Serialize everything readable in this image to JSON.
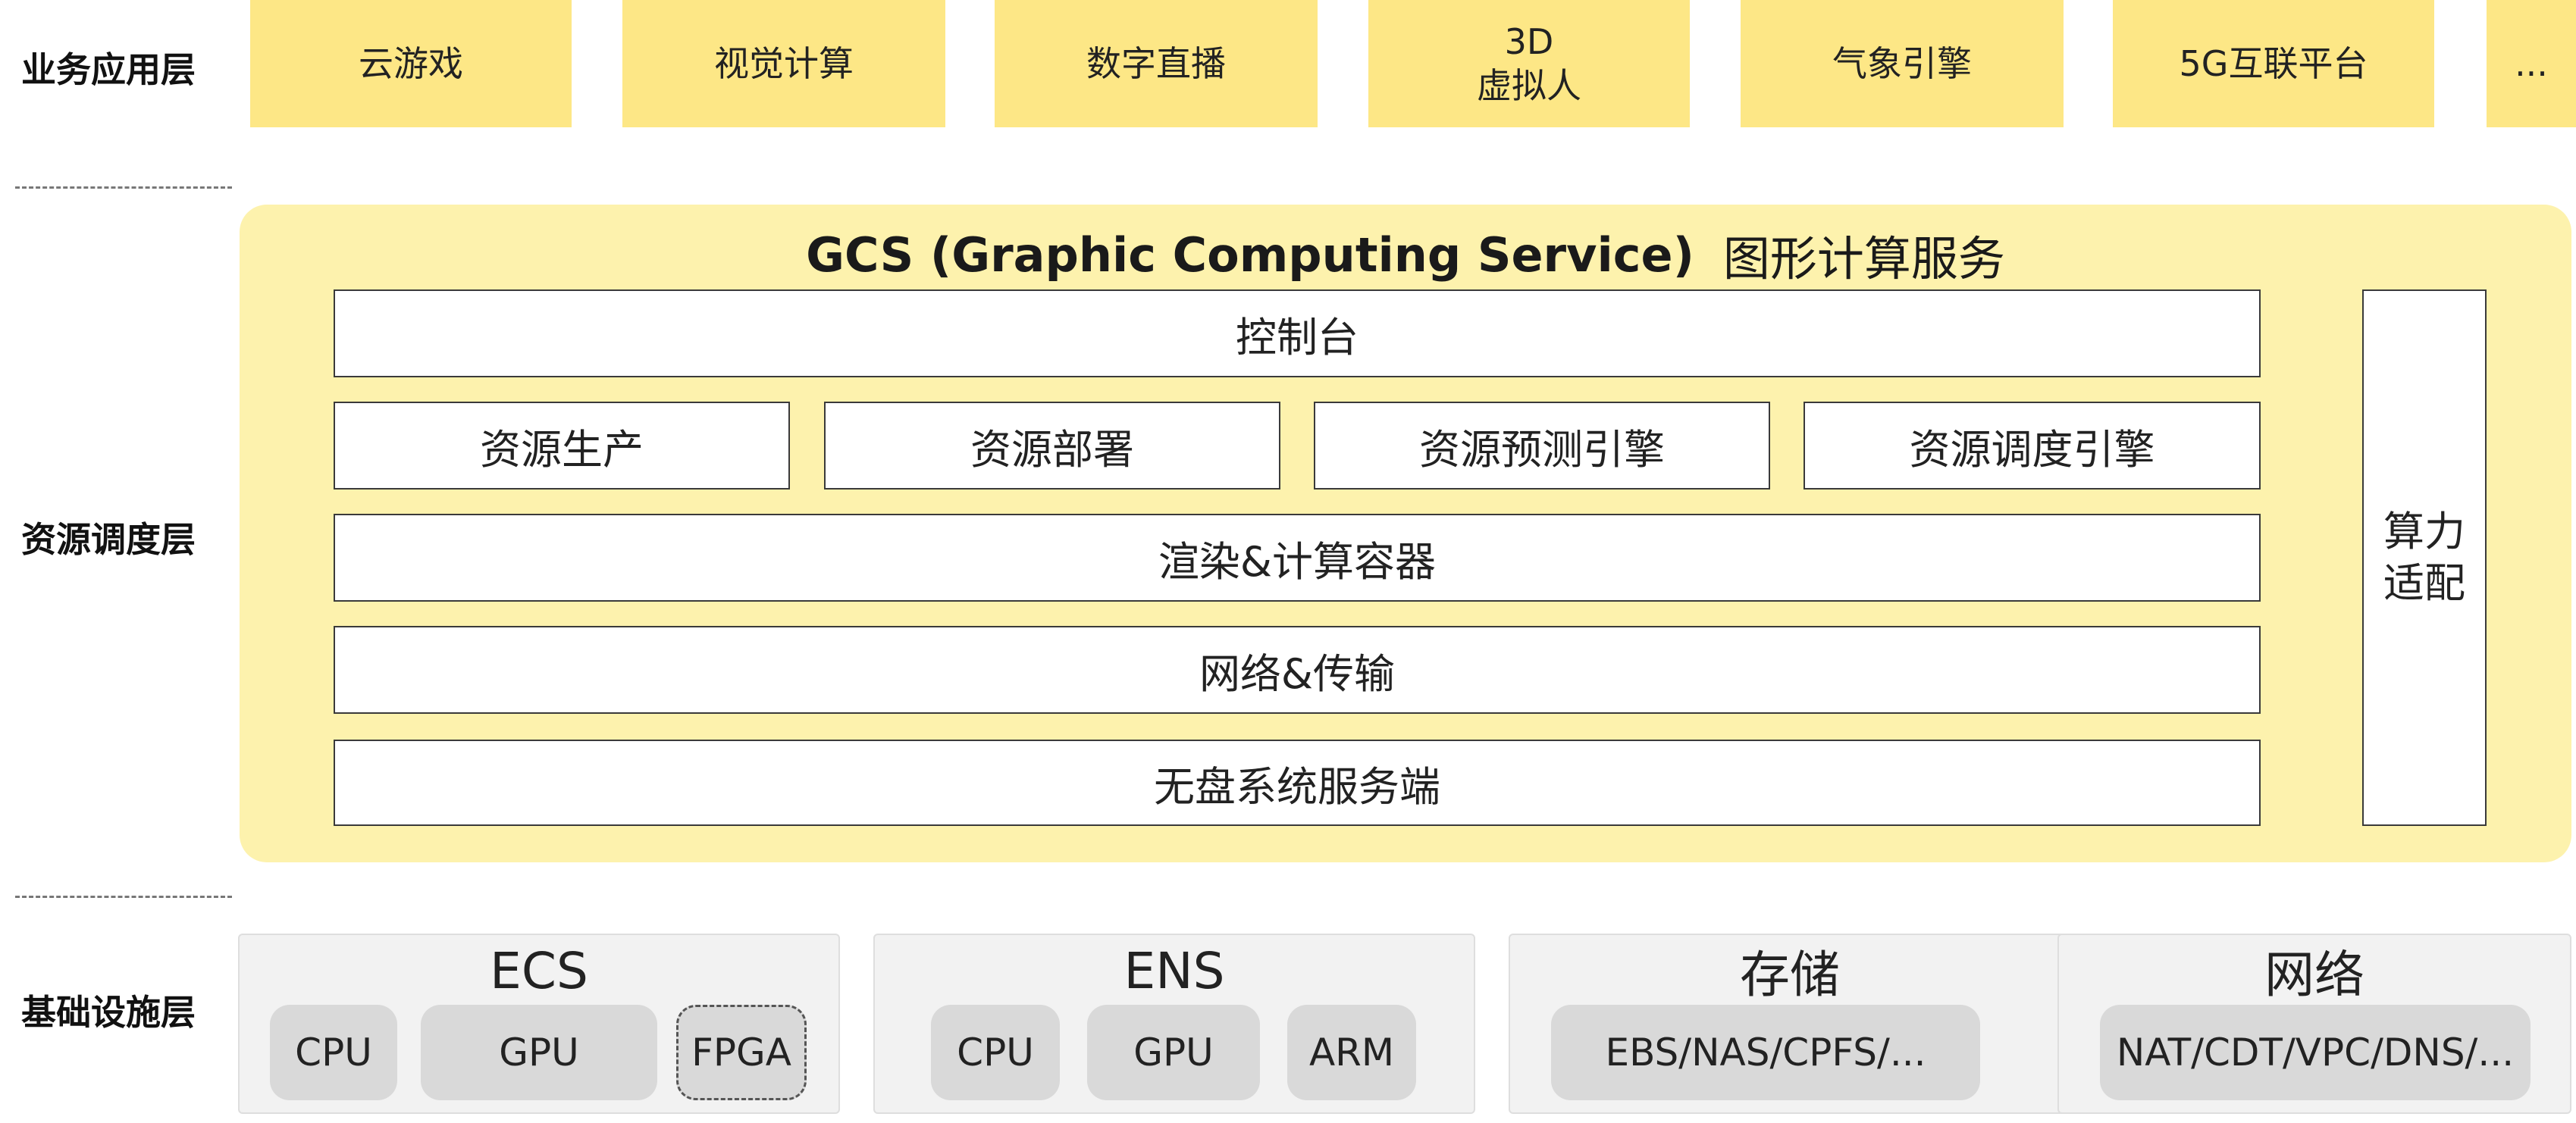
{
  "layers": {
    "application": "业务应用层",
    "resource": "资源调度层",
    "infrastructure": "基础设施层"
  },
  "apps": [
    "云游戏",
    "视觉计算",
    "数字直播",
    "3D\n虚拟人",
    "气象引擎",
    "5G互联平台",
    "..."
  ],
  "gcs": {
    "title_en": "GCS (Graphic Computing Service)",
    "title_zh": "图形计算服务",
    "console": "控制台",
    "resource_modules": [
      "资源生产",
      "资源部署",
      "资源预测引擎",
      "资源调度引擎"
    ],
    "render_container": "渲染&计算容器",
    "network_transport": "网络&传输",
    "diskless_server": "无盘系统服务端",
    "compute_adapt": "算力\n适配"
  },
  "infrastructure": [
    {
      "title": "ECS",
      "items": [
        "CPU",
        "GPU",
        "FPGA"
      ]
    },
    {
      "title": "ENS",
      "items": [
        "CPU",
        "GPU",
        "ARM"
      ]
    },
    {
      "title": "存储",
      "items": [
        "EBS/NAS/CPFS/..."
      ]
    },
    {
      "title": "网络",
      "items": [
        "NAT/CDT/VPC/DNS/..."
      ]
    }
  ],
  "colors": {
    "app_tile": "#fde786",
    "gcs_panel": "#fdf2ad",
    "infra_group": "#f2f2f2",
    "chip": "#d9d9d9"
  }
}
